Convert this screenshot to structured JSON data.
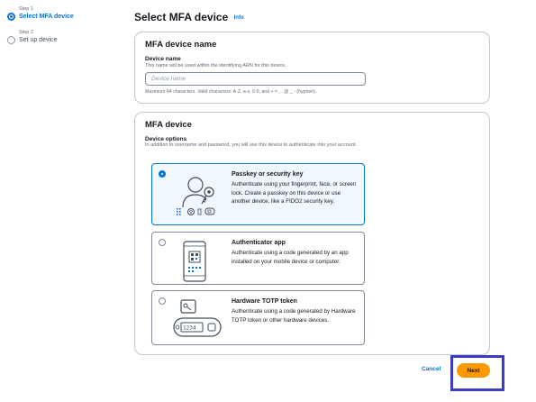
{
  "steps": [
    {
      "number": "Step 1",
      "name": "Select MFA device",
      "active": true
    },
    {
      "number": "Step 2",
      "name": "Set up device",
      "active": false
    }
  ],
  "page": {
    "title": "Select MFA device",
    "info_link": "Info"
  },
  "name_section": {
    "title": "MFA device name",
    "label": "Device name",
    "description": "This name will be used within the identifying ARN for this device.",
    "placeholder": "Device name",
    "value": "",
    "constraint": "Maximum 64 characters. Valid characters: A-Z, a-z, 0-9, and + = , . @ _ - (hyphen)."
  },
  "device_section": {
    "title": "MFA device",
    "label": "Device options",
    "description": "In addition to username and password, you will use this device to authenticate into your account.",
    "selected": "passkey",
    "options": [
      {
        "id": "passkey",
        "title": "Passkey or security key",
        "description": "Authenticate using your fingerprint, face, or screen lock. Create a passkey on this device or use another device, like a FIDO2 security key.",
        "icon": "passkey-illustration-icon"
      },
      {
        "id": "authenticator",
        "title": "Authenticator app",
        "description": "Authenticate using a code generated by an app installed on your mobile device or computer.",
        "icon": "phone-app-illustration-icon"
      },
      {
        "id": "totp",
        "title": "Hardware TOTP token",
        "description": "Authenticate using a code generated by Hardware TOTP token or other hardware devices.",
        "icon": "hardware-token-illustration-icon"
      }
    ]
  },
  "actions": {
    "cancel": "Cancel",
    "next": "Next"
  },
  "colors": {
    "accent": "#0972d3",
    "primary_button": "#ff9900",
    "highlight_box": "#3b3bc4"
  }
}
